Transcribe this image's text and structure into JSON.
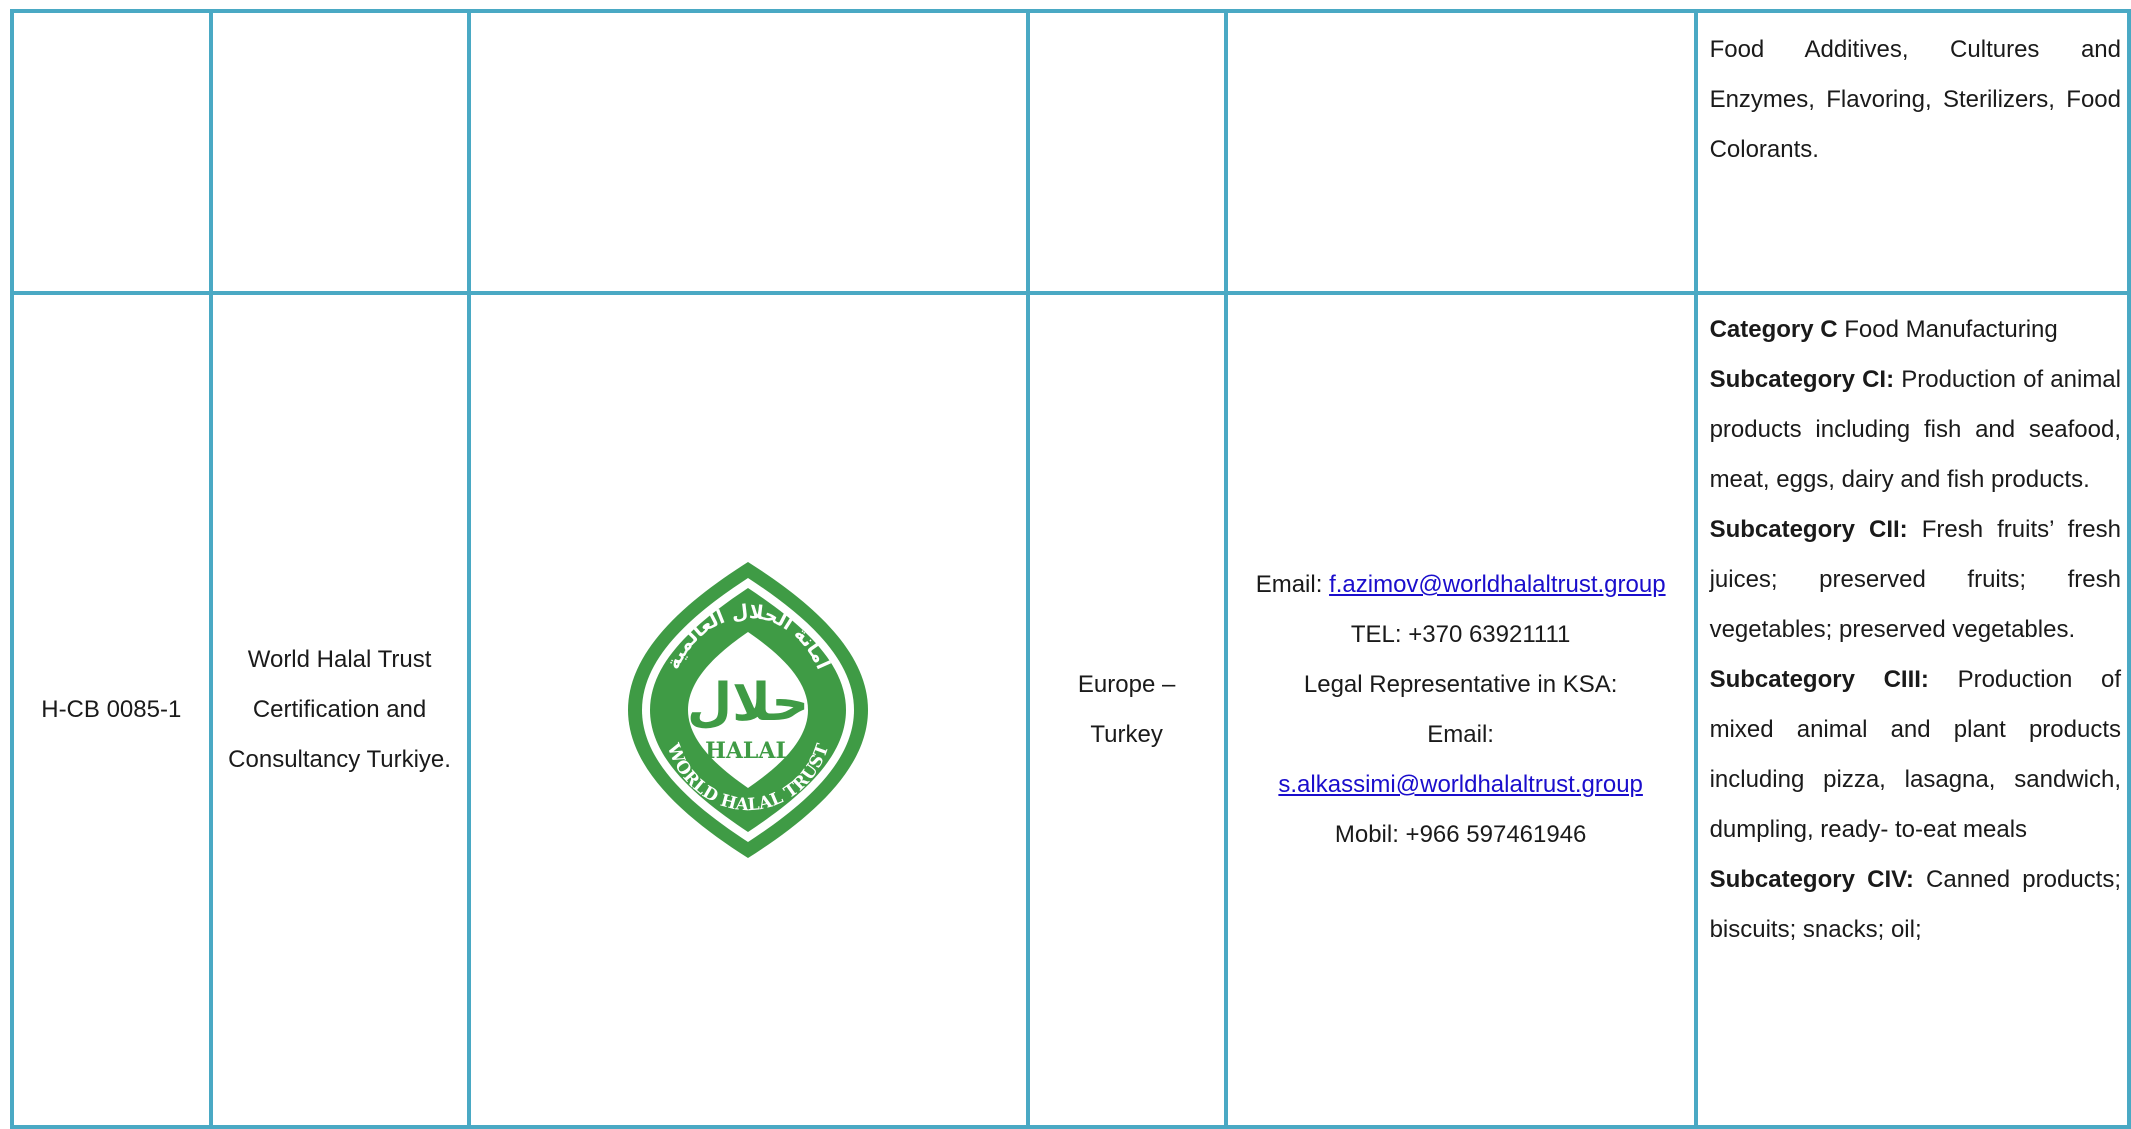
{
  "top_row": {
    "categories_text": "Food Additives, Cultures and Enzymes, Flavoring, Sterilizers, Food Colorants."
  },
  "entry": {
    "code": "H-CB 0085-1",
    "name_line1": "World Halal Trust",
    "name_line2": "Certification and",
    "name_line3": "Consultancy Turkiye.",
    "region_line1": "Europe –",
    "region_line2": "Turkey",
    "email_label": "Email:",
    "email": "f.azimov@worldhalaltrust.group",
    "tel": "TEL: +370 63921111",
    "legal_rep": "Legal Representative in KSA:",
    "email2_label": "Email:",
    "email2": "s.alkassimi@worldhalaltrust.group",
    "mobile": "Mobil: +966 597461946",
    "logo": {
      "arabic_text": "أمانة الحلال العالمية",
      "arabic_word": "حلال",
      "word": "HALAL",
      "ring_text": "WORLD HALAL TRUST",
      "color": "#3f9b45"
    },
    "category_title_bold": "Category C",
    "category_title_rest": " Food Manufacturing",
    "subcategories": [
      {
        "label": "Subcategory CI:",
        "text": " Production of animal products including fish and seafood, meat, eggs, dairy and fish products."
      },
      {
        "label": "Subcategory CII:",
        "text": " Fresh fruits’ fresh juices; preserved fruits; fresh vegetables; preserved vegetables."
      },
      {
        "label": "Subcategory CIII:",
        "text": " Production of mixed animal and plant products including pizza, lasagna, sandwich, dumpling, ready- to-eat meals"
      },
      {
        "label": "Subcategory CIV:",
        "text": " Canned products; biscuits; snacks; oil;"
      }
    ]
  },
  "colors": {
    "border": "#4aa9c4",
    "link": "#1a0dcc",
    "logo_green": "#3f9b45"
  }
}
